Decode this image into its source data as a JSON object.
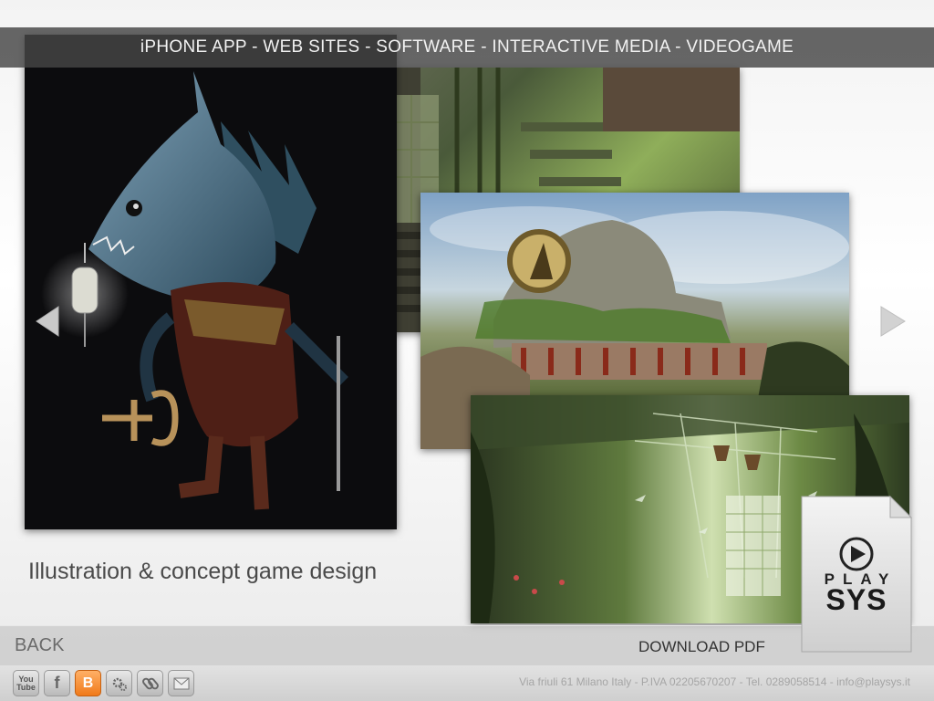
{
  "nav": {
    "text": "iPHONE APP - WEB SITES - SOFTWARE - INTERACTIVE MEDIA - VIDEOGAME"
  },
  "gallery": {
    "caption": "Illustration & concept game design",
    "prev_icon": "chevron-left-icon",
    "next_icon": "chevron-right-icon",
    "images": [
      "fish-creature-character",
      "green-interior-staircase",
      "overgrown-ruins-landscape",
      "greenhouse-interior"
    ]
  },
  "actions": {
    "back_label": "BACK",
    "download_label": "DOWNLOAD PDF"
  },
  "pdf_document": {
    "brand_top": "PLAY",
    "brand_bottom": "SYS",
    "icon": "play-icon"
  },
  "footer": {
    "social": [
      {
        "name": "youtube-icon",
        "text": "You Tube"
      },
      {
        "name": "facebook-icon",
        "text": "f"
      },
      {
        "name": "blogger-icon",
        "text": "B"
      },
      {
        "name": "settings-gears-icon",
        "text": ""
      },
      {
        "name": "link-icon",
        "text": ""
      },
      {
        "name": "mail-icon",
        "text": ""
      }
    ],
    "address": "Via friuli 61 Milano Italy - P.IVA 02205670207 - Tel. 0289058514 - info@playsys.it"
  },
  "colors": {
    "nav_bg": "#464646",
    "accent_blogger": "#f07a1a"
  }
}
